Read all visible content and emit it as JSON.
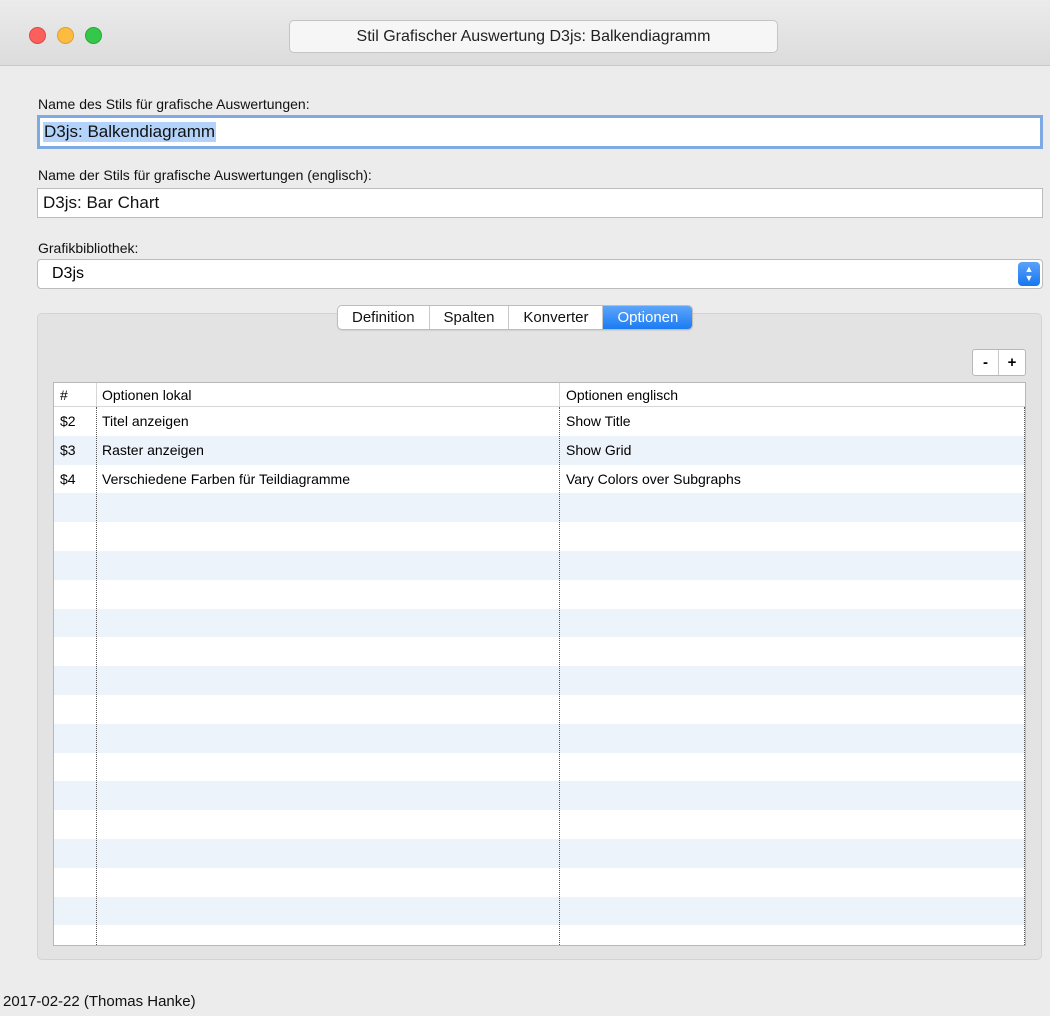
{
  "window": {
    "title": "Stil Grafischer Auswertung D3js: Balkendiagramm"
  },
  "form": {
    "name_label": "Name des Stils für grafische Auswertungen:",
    "name_value": "D3js: Balkendiagramm",
    "name_en_label": "Name der Stils für grafische Auswertungen (englisch):",
    "name_en_value": "D3js: Bar Chart",
    "library_label": "Grafikbibliothek:",
    "library_value": "D3js"
  },
  "tabs": [
    {
      "label": "Definition",
      "active": false
    },
    {
      "label": "Spalten",
      "active": false
    },
    {
      "label": "Konverter",
      "active": false
    },
    {
      "label": "Optionen",
      "active": true
    }
  ],
  "controls": {
    "minus_label": "-",
    "plus_label": "+"
  },
  "table": {
    "headers": [
      "#",
      "Optionen lokal",
      "Optionen englisch"
    ],
    "rows": [
      [
        "$2",
        "Titel anzeigen",
        "Show Title"
      ],
      [
        "$3",
        "Raster anzeigen",
        "Show Grid"
      ],
      [
        "$4",
        "Verschiedene Farben für Teildiagramme",
        "Vary Colors over Subgraphs"
      ]
    ]
  },
  "footer": {
    "text": "2017-02-22 (Thomas Hanke)"
  },
  "colors": {
    "accent": "#1b7cf3",
    "selection": "#b3d3fb",
    "row_alt": "#edf3fa"
  }
}
